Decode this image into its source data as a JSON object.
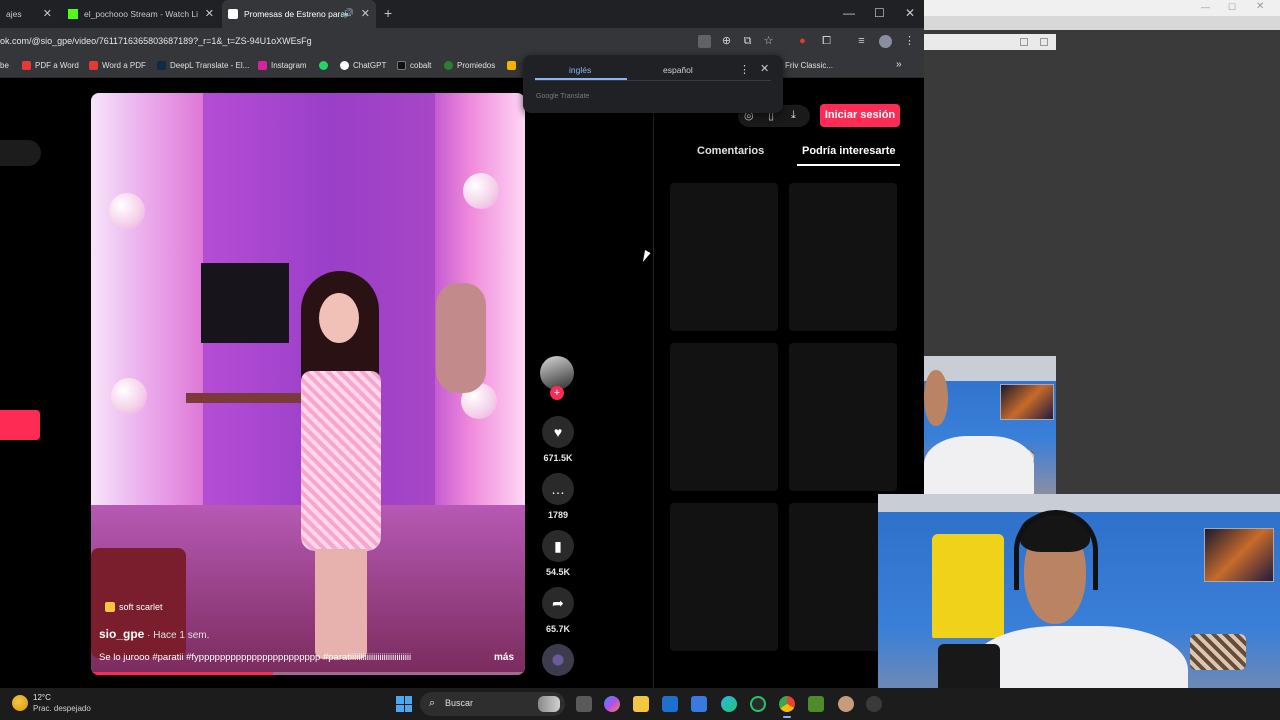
{
  "browser": {
    "tabs": [
      {
        "title": "ajes",
        "favicon_color": "#8a8a8a"
      },
      {
        "title": "el_pochooo Stream - Watch Li",
        "favicon_color": "#53fc18"
      },
      {
        "title": "Promesas de Estreno para",
        "favicon_color": "#ffffff"
      }
    ],
    "new_tab_icon": "plus-icon",
    "url": "ok.com/@sio_gpe/video/761171636580368718​9?_r=1&_t=ZS-94U1oXWEsFg",
    "bookmarks": [
      {
        "label": "be",
        "color": "#c4302b"
      },
      {
        "label": "PDF a Word",
        "color": "#e53935"
      },
      {
        "label": "Word a PDF",
        "color": "#e53935"
      },
      {
        "label": "DeepL Translate - El...",
        "color": "#0f2b46"
      },
      {
        "label": "Instagram",
        "color": "#d6249f"
      },
      {
        "label": "",
        "color": "#25d366"
      },
      {
        "label": "ChatGPT",
        "color": "#ffffff"
      },
      {
        "label": "cobalt",
        "color": "#111111"
      },
      {
        "label": "Promiedos",
        "color": "#2e7d32"
      },
      {
        "label": "Friv Classic...",
        "color": "#f4b400"
      }
    ],
    "overflow_icon": "chevron-double-right-icon"
  },
  "translate_popup": {
    "source_lang": "inglés",
    "target_lang": "español",
    "brand": "Google Translate"
  },
  "video": {
    "sound_label": "soft scarlet",
    "author": "sio_gpe",
    "posted": " · Hace 1 sem.",
    "caption": "Se lo jurooo #paratii #fyppppppppppppppppppppppp #paratiiiiiiiiiiiiiiiiiiiiiiiiiiiii",
    "more_label": "más",
    "progress": 0.42
  },
  "actions": {
    "likes": "671.5K",
    "comments": "1789",
    "saves": "54.5K",
    "shares": "65.7K"
  },
  "right_panel": {
    "login_label": "Iniciar sesión",
    "tab_comments": "Comentarios",
    "tab_suggested": "Podría interesarte"
  },
  "taskbar": {
    "temperature": "12°C",
    "weather": "Prac. despejado",
    "search_placeholder": "Buscar"
  },
  "colors": {
    "accent": "#fe2c55",
    "link": "#8ab4f8"
  }
}
